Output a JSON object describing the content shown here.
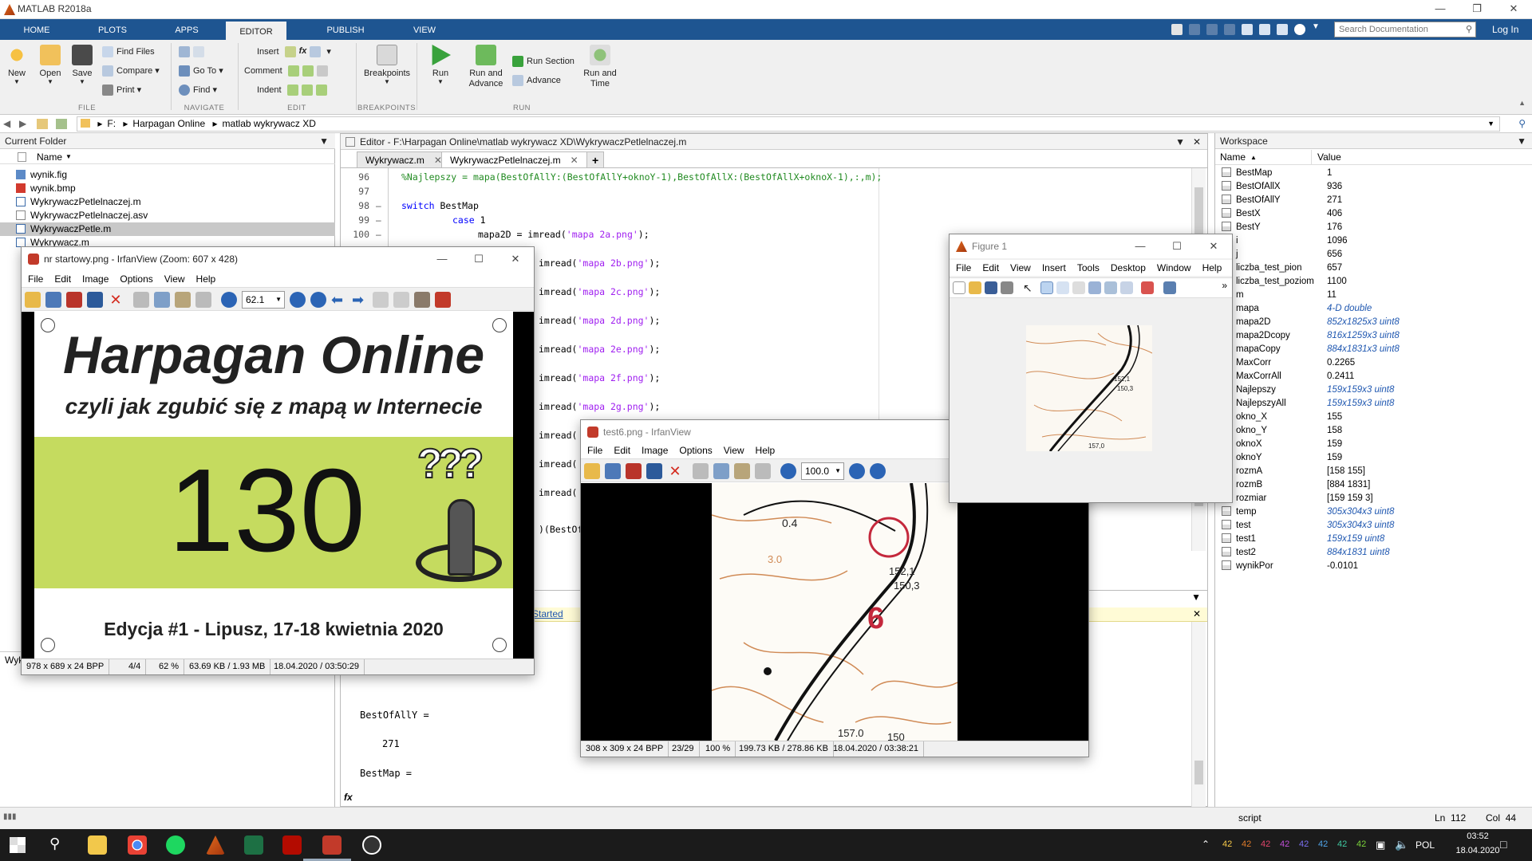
{
  "app": {
    "title": "MATLAB R2018a"
  },
  "ribbon_tabs": [
    "HOME",
    "PLOTS",
    "APPS",
    "EDITOR",
    "PUBLISH",
    "VIEW"
  ],
  "search": {
    "placeholder": "Search Documentation"
  },
  "login": "Log In",
  "ribbon": {
    "new": "New",
    "open": "Open",
    "save": "Save",
    "find_files": "Find Files",
    "compare": "Compare",
    "print": "Print",
    "go_to": "Go To",
    "find": "Find",
    "insert": "Insert",
    "comment": "Comment",
    "indent": "Indent",
    "breakpoints": "Breakpoints",
    "run": "Run",
    "run_and_advance": "Run and\nAdvance",
    "run_section": "Run Section",
    "advance": "Advance",
    "run_and_time": "Run and\nTime",
    "groups": {
      "file": "FILE",
      "navigate": "NAVIGATE",
      "edit": "EDIT",
      "breakpoints": "BREAKPOINTS",
      "run": "RUN"
    }
  },
  "address": {
    "path": [
      "F:",
      "Harpagan Online",
      "matlab wykrywacz XD"
    ]
  },
  "current_folder": {
    "title": "Current Folder",
    "column": "Name",
    "files": [
      "wynik.fig",
      "wynik.bmp",
      "WykrywaczPetlelnaczej.m",
      "WykrywaczPetlelnaczej.asv",
      "WykrywaczPetle.m",
      "Wykrywacz.m"
    ],
    "selected": "WykrywaczPetle.m",
    "bottom_label": "Wyk"
  },
  "editor": {
    "title": "Editor - F:\\Harpagan Online\\matlab wykrywacz XD\\WykrywaczPetlelnaczej.m",
    "tabs": [
      "Wykrywacz.m",
      "WykrywaczPetlelnaczej.m"
    ],
    "active_tab": "WykrywaczPetlelnaczej.m",
    "line_numbers": [
      "96",
      "97",
      "98",
      "99",
      "100"
    ],
    "line96": "%Najlepszy = mapa(BestOfAllY:(BestOfAllY+oknoY-1),BestOfAllX:(BestOfAllX+oknoX-1),:,m);",
    "line98a": "switch",
    "line98b": " BestMap",
    "line99a": "case",
    "line99b": " 1",
    "line100": "mapa2D = imread(",
    "line100s": "'mapa 2a.png'",
    "partial_lines": [
      {
        "pre": "imread(",
        "s": "'mapa 2b.png'",
        "post": ");"
      },
      {
        "pre": "imread(",
        "s": "'mapa 2c.png'",
        "post": ");"
      },
      {
        "pre": "imread(",
        "s": "'mapa 2d.png'",
        "post": ");"
      },
      {
        "pre": "imread(",
        "s": "'mapa 2e.png'",
        "post": ");"
      },
      {
        "pre": "imread(",
        "s": "'mapa 2f.png'",
        "post": ");"
      },
      {
        "pre": "imread(",
        "s": "'mapa 2g.png'",
        "post": ");"
      }
    ],
    "partial_imread": "imread(",
    "partial_best": ")(BestOf",
    "started_link": "Started",
    "cmd_lines": [
      "BestOfAllY =",
      "271",
      "BestMap ="
    ],
    "fx": "fx"
  },
  "workspace": {
    "title": "Workspace",
    "col_name": "Name",
    "col_value": "Value",
    "vars": [
      {
        "name": "BestMap",
        "value": "1",
        "italic": false
      },
      {
        "name": "BestOfAllX",
        "value": "936",
        "italic": false
      },
      {
        "name": "BestOfAllY",
        "value": "271",
        "italic": false
      },
      {
        "name": "BestX",
        "value": "406",
        "italic": false
      },
      {
        "name": "BestY",
        "value": "176",
        "italic": false
      },
      {
        "name": "i",
        "value": "1096",
        "italic": false
      },
      {
        "name": "j",
        "value": "656",
        "italic": false
      },
      {
        "name": "liczba_test_pion",
        "value": "657",
        "italic": false
      },
      {
        "name": "liczba_test_poziom",
        "value": "1100",
        "italic": false
      },
      {
        "name": "m",
        "value": "11",
        "italic": false
      },
      {
        "name": "mapa",
        "value": "4-D double",
        "italic": true
      },
      {
        "name": "mapa2D",
        "value": "852x1825x3 uint8",
        "italic": true
      },
      {
        "name": "mapa2Dcopy",
        "value": "816x1259x3 uint8",
        "italic": true
      },
      {
        "name": "mapaCopy",
        "value": "884x1831x3 uint8",
        "italic": true
      },
      {
        "name": "MaxCorr",
        "value": "0.2265",
        "italic": false
      },
      {
        "name": "MaxCorrAll",
        "value": "0.2411",
        "italic": false
      },
      {
        "name": "Najlepszy",
        "value": "159x159x3 uint8",
        "italic": true
      },
      {
        "name": "NajlepszyAll",
        "value": "159x159x3 uint8",
        "italic": true
      },
      {
        "name": "okno_X",
        "value": "155",
        "italic": false
      },
      {
        "name": "okno_Y",
        "value": "158",
        "italic": false
      },
      {
        "name": "oknoX",
        "value": "159",
        "italic": false
      },
      {
        "name": "oknoY",
        "value": "159",
        "italic": false
      },
      {
        "name": "rozmA",
        "value": "[158 155]",
        "italic": false
      },
      {
        "name": "rozmB",
        "value": "[884 1831]",
        "italic": false
      },
      {
        "name": "rozmiar",
        "value": "[159 159 3]",
        "italic": false
      },
      {
        "name": "temp",
        "value": "305x304x3 uint8",
        "italic": true
      },
      {
        "name": "test",
        "value": "305x304x3 uint8",
        "italic": true
      },
      {
        "name": "test1",
        "value": "159x159 uint8",
        "italic": true
      },
      {
        "name": "test2",
        "value": "884x1831 uint8",
        "italic": true
      },
      {
        "name": "wynikPor",
        "value": "-0.0101",
        "italic": false
      }
    ]
  },
  "statusbar": {
    "mode": "script",
    "ln_label": "Ln",
    "ln": "112",
    "col_label": "Col",
    "col": "44"
  },
  "irfan1": {
    "title": "nr startowy.png - IrfanView (Zoom: 607 x 428)",
    "menu": [
      "File",
      "Edit",
      "Image",
      "Options",
      "View",
      "Help"
    ],
    "zoom": "62.1",
    "poster_title": "Harpagan Online",
    "poster_subtitle": "czyli jak zgubić się z mapą w Internecie",
    "poster_number": "130",
    "poster_marks": "???",
    "poster_footer": "Edycja #1 - Lipusz, 17-18 kwietnia 2020",
    "status": [
      "978 x 689 x 24 BPP",
      "4/4",
      "62 %",
      "63.69 KB / 1.93 MB",
      "18.04.2020 / 03:50:29"
    ]
  },
  "irfan2": {
    "title": "test6.png - IrfanView",
    "menu": [
      "File",
      "Edit",
      "Image",
      "Options",
      "View",
      "Help"
    ],
    "zoom": "100.0",
    "map_labels": [
      "152,1",
      "150,3",
      "6",
      "0.4",
      "3.0",
      "157.0",
      "150"
    ],
    "status": [
      "308 x 309 x 24 BPP",
      "23/29",
      "100 %",
      "199.73 KB / 278.86 KB",
      "18.04.2020 / 03:38:21"
    ]
  },
  "figure1": {
    "title": "Figure 1",
    "menu": [
      "File",
      "Edit",
      "View",
      "Insert",
      "Tools",
      "Desktop",
      "Window",
      "Help"
    ],
    "map_labels": [
      "152,1",
      "150,3",
      "157,0"
    ]
  },
  "taskbar": {
    "lang": "POL",
    "time": "03:52",
    "date": "18.04.2020",
    "tray_numbers": [
      "42",
      "42",
      "42",
      "42",
      "42",
      "42",
      "42",
      "42"
    ]
  },
  "colors": {
    "ribbon_blue": "#1e5591",
    "workspace_italic": "#1f57b0",
    "poster_green": "#c5db5f"
  }
}
